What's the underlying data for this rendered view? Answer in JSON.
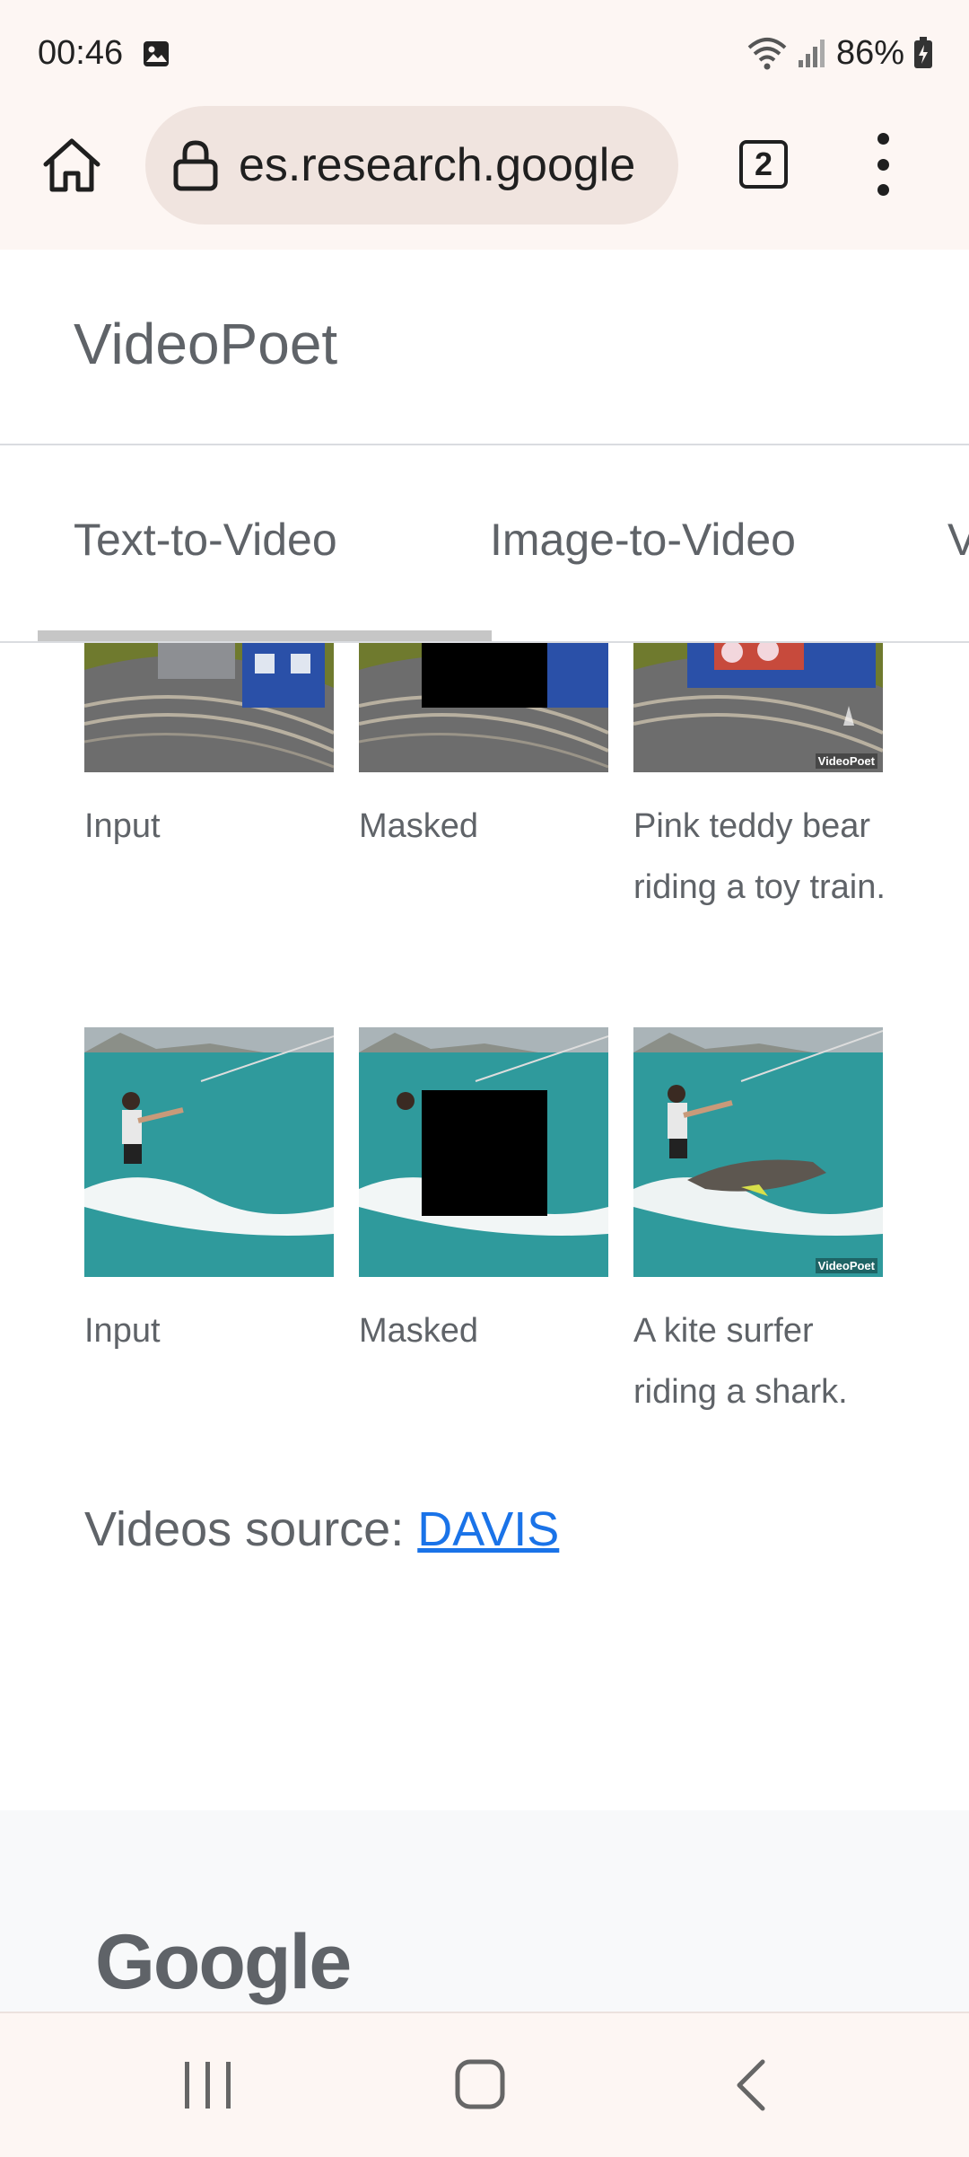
{
  "status_bar": {
    "time": "00:46",
    "battery": "86%"
  },
  "browser": {
    "url": "es.research.google",
    "tab_count": "2"
  },
  "site": {
    "title": "VideoPoet"
  },
  "tabs": [
    {
      "label": "Text-to-Video"
    },
    {
      "label": "Image-to-Video"
    },
    {
      "label": "V"
    }
  ],
  "rows": [
    {
      "captions": [
        "Input",
        "Masked",
        "Pink teddy bear riding a toy train."
      ]
    },
    {
      "captions": [
        "Input",
        "Masked",
        "A kite surfer riding a shark."
      ]
    }
  ],
  "watermark": "VideoPoet",
  "source": {
    "label": "Videos source:",
    "link": "DAVIS"
  },
  "footer": {
    "logo_text": "Google"
  },
  "colors": {
    "accent_link": "#1a73e8",
    "browser_chrome": "#fdf6f3",
    "url_pill": "#f0e4df"
  }
}
